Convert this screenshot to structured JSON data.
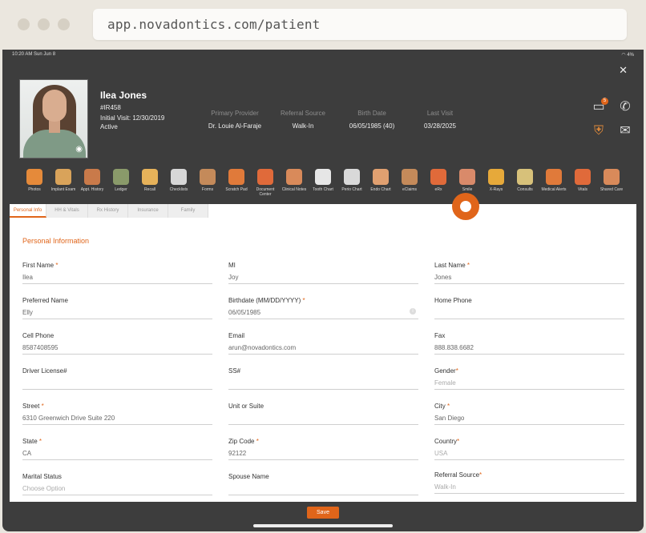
{
  "browser": {
    "url": "app.novadontics.com/patient"
  },
  "status_bar": {
    "time": "10:20 AM  Sun Jun 8",
    "battery": "4%"
  },
  "patient": {
    "name": "Ilea Jones",
    "id": "#IR458",
    "initial_visit": "Initial Visit: 12/30/2019",
    "status": "Active"
  },
  "summary": {
    "primary_provider": {
      "label": "Primary Provider",
      "value": "Dr. Louie Al-Faraje"
    },
    "referral_source": {
      "label": "Referral Source",
      "value": "Walk-In"
    },
    "birth_date": {
      "label": "Birth Date",
      "value": "06/05/1985 (40)"
    },
    "last_visit": {
      "label": "Last Visit",
      "value": "03/28/2025"
    }
  },
  "header_icons": {
    "messages": "chat-icon",
    "messages_badge": "5",
    "phone": "phone-icon",
    "alert": "shield-icon",
    "mail": "mail-icon"
  },
  "toolbar": [
    {
      "label": "Photos",
      "icon": "camera-icon",
      "color": "#e58a3a"
    },
    {
      "label": "Implant Exam",
      "icon": "implant-icon",
      "color": "#d9a35a"
    },
    {
      "label": "Appt. History",
      "icon": "clock-icon",
      "color": "#c97a4a"
    },
    {
      "label": "Ledger",
      "icon": "ledger-icon",
      "color": "#8a9a6a"
    },
    {
      "label": "Recall",
      "icon": "recall-icon",
      "color": "#e6b25a"
    },
    {
      "label": "Checklists",
      "icon": "checklist-icon",
      "color": "#d7d7d7"
    },
    {
      "label": "Forms",
      "icon": "forms-icon",
      "color": "#c48a5a"
    },
    {
      "label": "Scratch Pad",
      "icon": "pen-icon",
      "color": "#e07a3a"
    },
    {
      "label": "Document Center",
      "icon": "cube-icon",
      "color": "#e06a3a"
    },
    {
      "label": "Clinical Notes",
      "icon": "notes-icon",
      "color": "#d98a5a"
    },
    {
      "label": "Tooth Chart",
      "icon": "tooth-icon",
      "color": "#e6e6e6"
    },
    {
      "label": "Perio Chart",
      "icon": "perio-icon",
      "color": "#d9d9d9"
    },
    {
      "label": "Endo Chart",
      "icon": "endo-icon",
      "color": "#e0a070"
    },
    {
      "label": "eClaims",
      "icon": "claims-icon",
      "color": "#c48a5a"
    },
    {
      "label": "eRx",
      "icon": "pill-icon",
      "color": "#e06a3a"
    },
    {
      "label": "Smile",
      "icon": "smile-icon",
      "color": "#d98a6a"
    },
    {
      "label": "X-Rays",
      "icon": "radiation-icon",
      "color": "#e6a93a"
    },
    {
      "label": "Consults",
      "icon": "consults-icon",
      "color": "#d7c17a"
    },
    {
      "label": "Medical Alerts",
      "icon": "medical-cross-icon",
      "color": "#e07a3a"
    },
    {
      "label": "Vitals",
      "icon": "pulse-icon",
      "color": "#e06a3a"
    },
    {
      "label": "Shared Care",
      "icon": "shared-icon",
      "color": "#d98a5a"
    }
  ],
  "tabs": [
    {
      "label": "Personal Info"
    },
    {
      "label": "HH & Vitals"
    },
    {
      "label": "Rx History"
    },
    {
      "label": "Insurance"
    },
    {
      "label": "Family"
    }
  ],
  "section_title": "Personal Information",
  "fields": {
    "first_name": {
      "label": "First Name",
      "required": true,
      "value": "Ilea"
    },
    "mi": {
      "label": "MI",
      "value": "Joy"
    },
    "last_name": {
      "label": "Last Name",
      "required": true,
      "value": "Jones"
    },
    "preferred_name": {
      "label": "Preferred Name",
      "value": "Elly"
    },
    "birthdate": {
      "label": "Birthdate (MM/DD/YYYY)",
      "required": true,
      "value": "06/05/1985"
    },
    "home_phone": {
      "label": "Home Phone",
      "value": ""
    },
    "cell_phone": {
      "label": "Cell Phone",
      "value": "8587408595"
    },
    "email": {
      "label": "Email",
      "value": "arun@novadontics.com"
    },
    "fax": {
      "label": "Fax",
      "value": "888.838.6682"
    },
    "drivers_license": {
      "label": "Driver License#",
      "value": ""
    },
    "ssn": {
      "label": "SS#",
      "value": ""
    },
    "gender": {
      "label": "Gender",
      "required": true,
      "placeholder": "Female"
    },
    "street": {
      "label": "Street",
      "required": true,
      "value": "6310 Greenwich Drive Suite 220"
    },
    "unit": {
      "label": "Unit or Suite",
      "value": ""
    },
    "city": {
      "label": "City",
      "required": true,
      "value": "San Diego"
    },
    "state": {
      "label": "State",
      "required": true,
      "value": "CA"
    },
    "zip": {
      "label": "Zip Code",
      "required": true,
      "value": "92122"
    },
    "country": {
      "label": "Country",
      "required": true,
      "placeholder": "USA"
    },
    "marital_status": {
      "label": "Marital Status",
      "placeholder": "Choose Option"
    },
    "spouse_name": {
      "label": "Spouse Name",
      "value": ""
    },
    "referral_source": {
      "label": "Referral Source",
      "required": true,
      "placeholder": "Walk-In"
    }
  },
  "req_mark": "*",
  "save_label": "Save",
  "colors": {
    "accent": "#e0651a",
    "device_bg": "#3d3d3d"
  }
}
